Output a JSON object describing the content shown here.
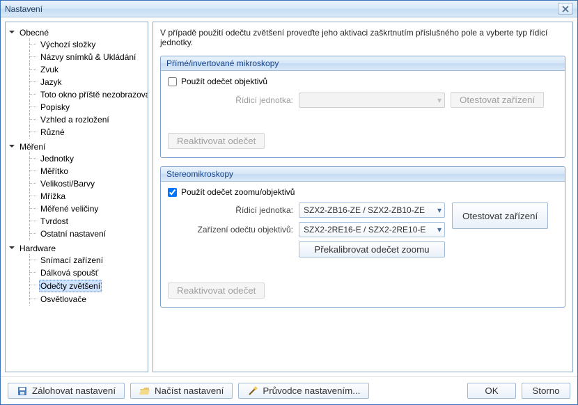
{
  "window": {
    "title": "Nastavení"
  },
  "intro": "V případě použití odečtu zvětšení proveďte jeho aktivaci zaškrtnutím příslušného pole a vyberte typ řídicí jednotky.",
  "tree": {
    "obecne": {
      "label": "Obecné",
      "items": [
        "Výchozí složky",
        "Názvy snímků & Ukládání",
        "Zvuk",
        "Jazyk",
        "Toto okno příště nezobrazovat...",
        "Popisky",
        "Vzhled a rozložení",
        "Různé"
      ]
    },
    "mereni": {
      "label": "Měření",
      "items": [
        "Jednotky",
        "Měřítko",
        "Velikosti/Barvy",
        "Mřížka",
        "Měřené veličiny",
        "Tvrdost",
        "Ostatní nastavení"
      ]
    },
    "hardware": {
      "label": "Hardware",
      "items": [
        "Snímací zařízení",
        "Dálková spoušť",
        "Odečty zvětšení",
        "Osvětlovače"
      ],
      "selected": "Odečty zvětšení"
    }
  },
  "group1": {
    "title": "Přímé/invertované mikroskopy",
    "use_label": "Použít odečet objektivů",
    "use_checked": false,
    "control_unit_label": "Řídicí jednotka:",
    "control_unit_value": "",
    "test_btn": "Otestovat zařízení",
    "reactivate_btn": "Reaktivovat odečet"
  },
  "group2": {
    "title": "Stereomikroskopy",
    "use_label": "Použít odečet zoomu/objektivů",
    "use_checked": true,
    "control_unit_label": "Řídicí jednotka:",
    "control_unit_value": "SZX2-ZB16-ZE / SZX2-ZB10-ZE",
    "lens_device_label": "Zařízení odečtu objektivů:",
    "lens_device_value": "SZX2-2RE16-E / SZX2-2RE10-E",
    "test_btn": "Otestovat zařízení",
    "recalibrate_btn": "Překalibrovat odečet zoomu",
    "reactivate_btn": "Reaktivovat odečet"
  },
  "buttons": {
    "backup": "Zálohovat nastavení",
    "load": "Načíst nastavení",
    "wizard": "Průvodce nastavením...",
    "ok": "OK",
    "cancel": "Storno"
  }
}
